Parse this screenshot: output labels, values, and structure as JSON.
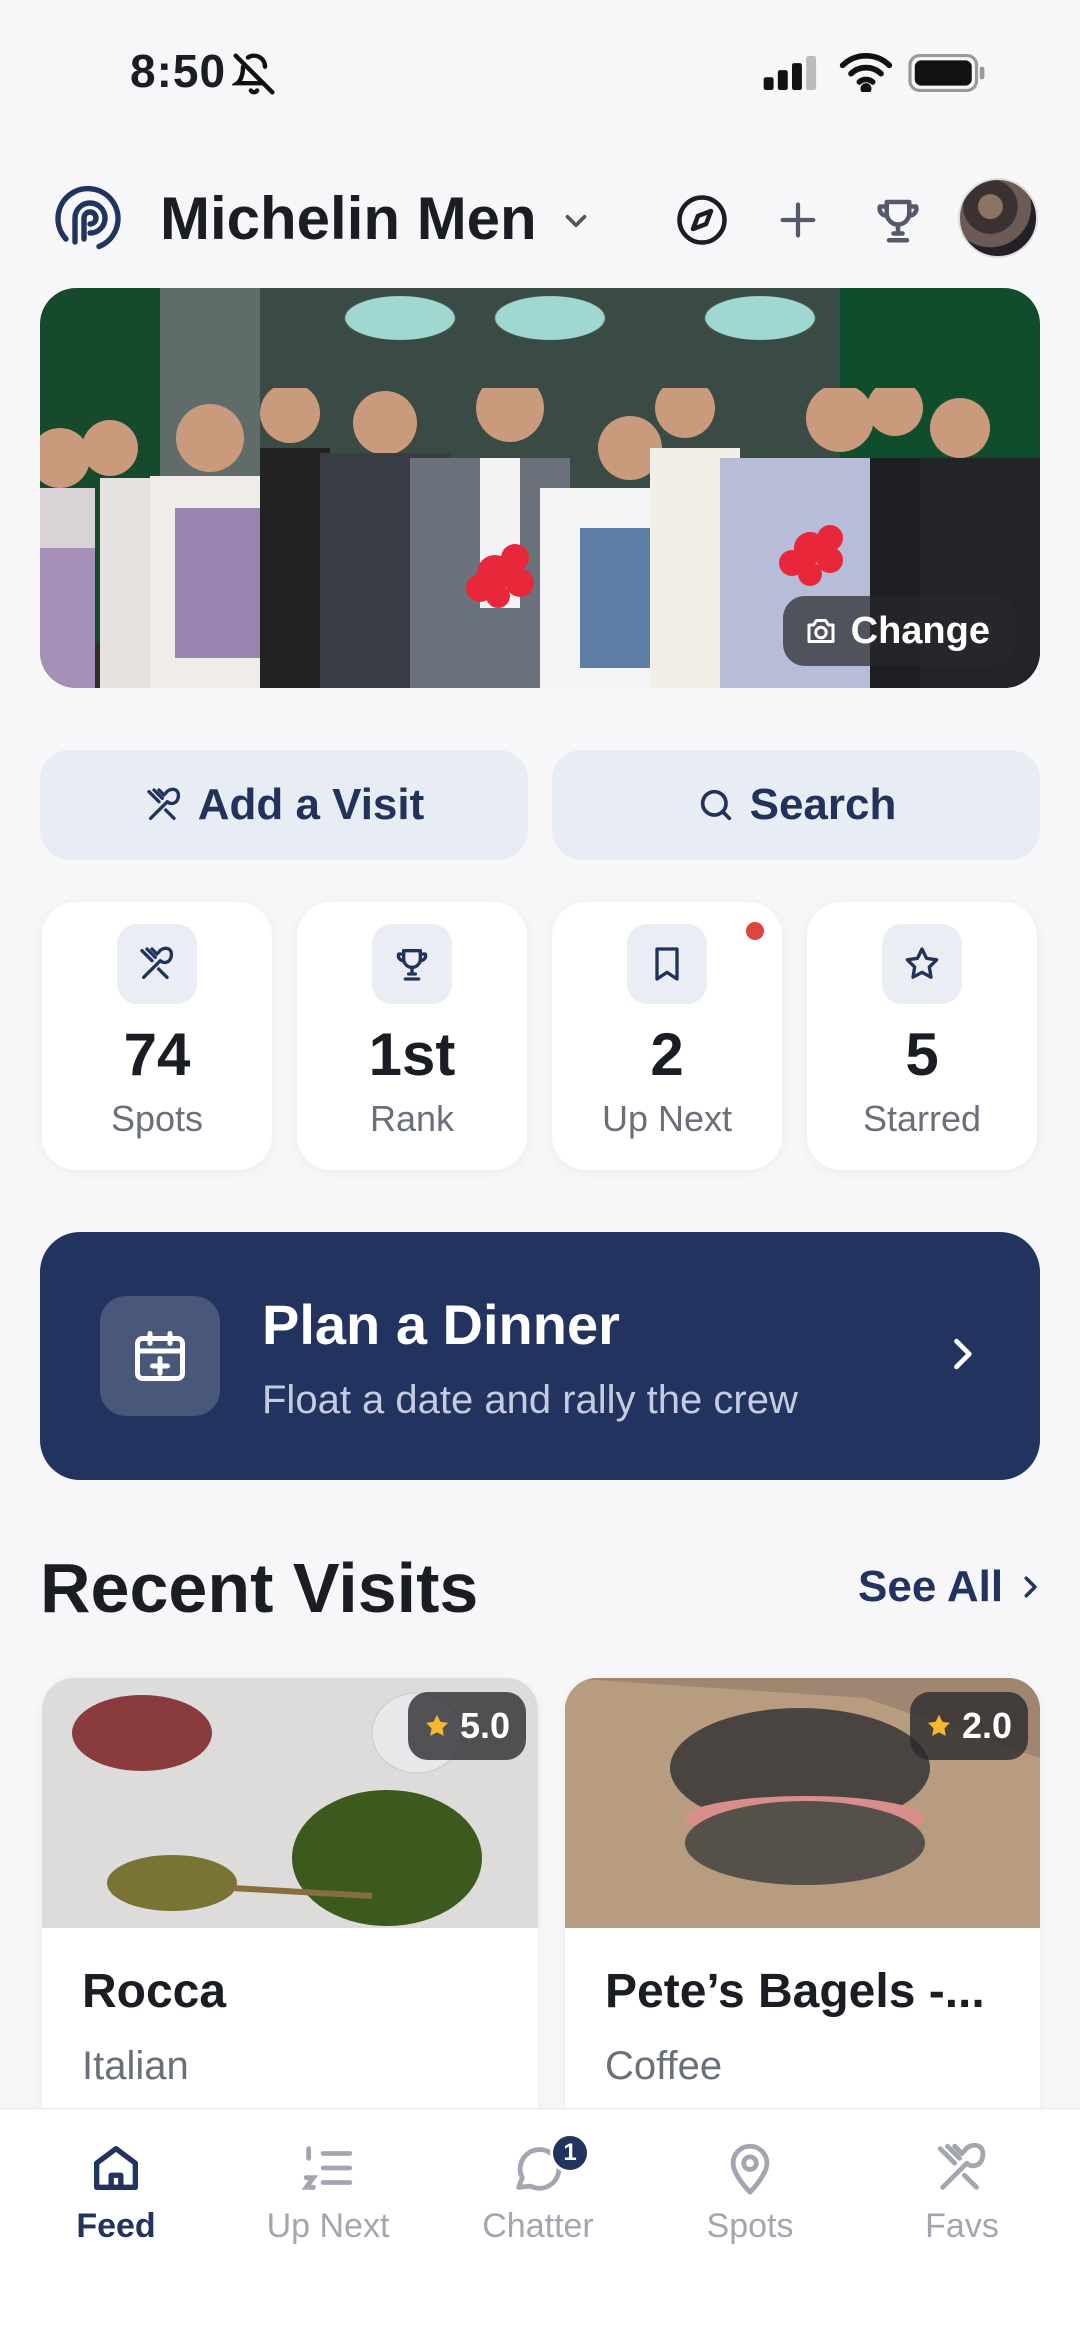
{
  "status_bar": {
    "time": "8:50"
  },
  "header": {
    "group_name": "Michelin Men",
    "icons": [
      "compass-icon",
      "plus-icon",
      "trophy-icon"
    ]
  },
  "hero": {
    "change_label": "Change"
  },
  "actions": {
    "add_visit": "Add a Visit",
    "search": "Search"
  },
  "stats": [
    {
      "icon": "utensils-icon",
      "value": "74",
      "label": "Spots"
    },
    {
      "icon": "trophy-icon",
      "value": "1st",
      "label": "Rank"
    },
    {
      "icon": "bookmark-icon",
      "value": "2",
      "label": "Up Next",
      "has_dot": true
    },
    {
      "icon": "star-icon",
      "value": "5",
      "label": "Starred"
    }
  ],
  "plan": {
    "title": "Plan a Dinner",
    "subtitle": "Float a date and rally the crew"
  },
  "recent": {
    "title": "Recent Visits",
    "see_all": "See All",
    "cards": [
      {
        "name": "Rocca",
        "category": "Italian",
        "rating": "5.0"
      },
      {
        "name": "Pete’s Bagels -...",
        "category": "Coffee",
        "rating": "2.0"
      }
    ]
  },
  "tabs": [
    {
      "label": "Feed",
      "active": true
    },
    {
      "label": "Up Next"
    },
    {
      "label": "Chatter",
      "badge": "1"
    },
    {
      "label": "Spots"
    },
    {
      "label": "Favs"
    }
  ],
  "colors": {
    "accent": "#22335f",
    "background": "#f7f7f9",
    "action_bg": "#e8ecf4",
    "dot": "#e0443e"
  }
}
